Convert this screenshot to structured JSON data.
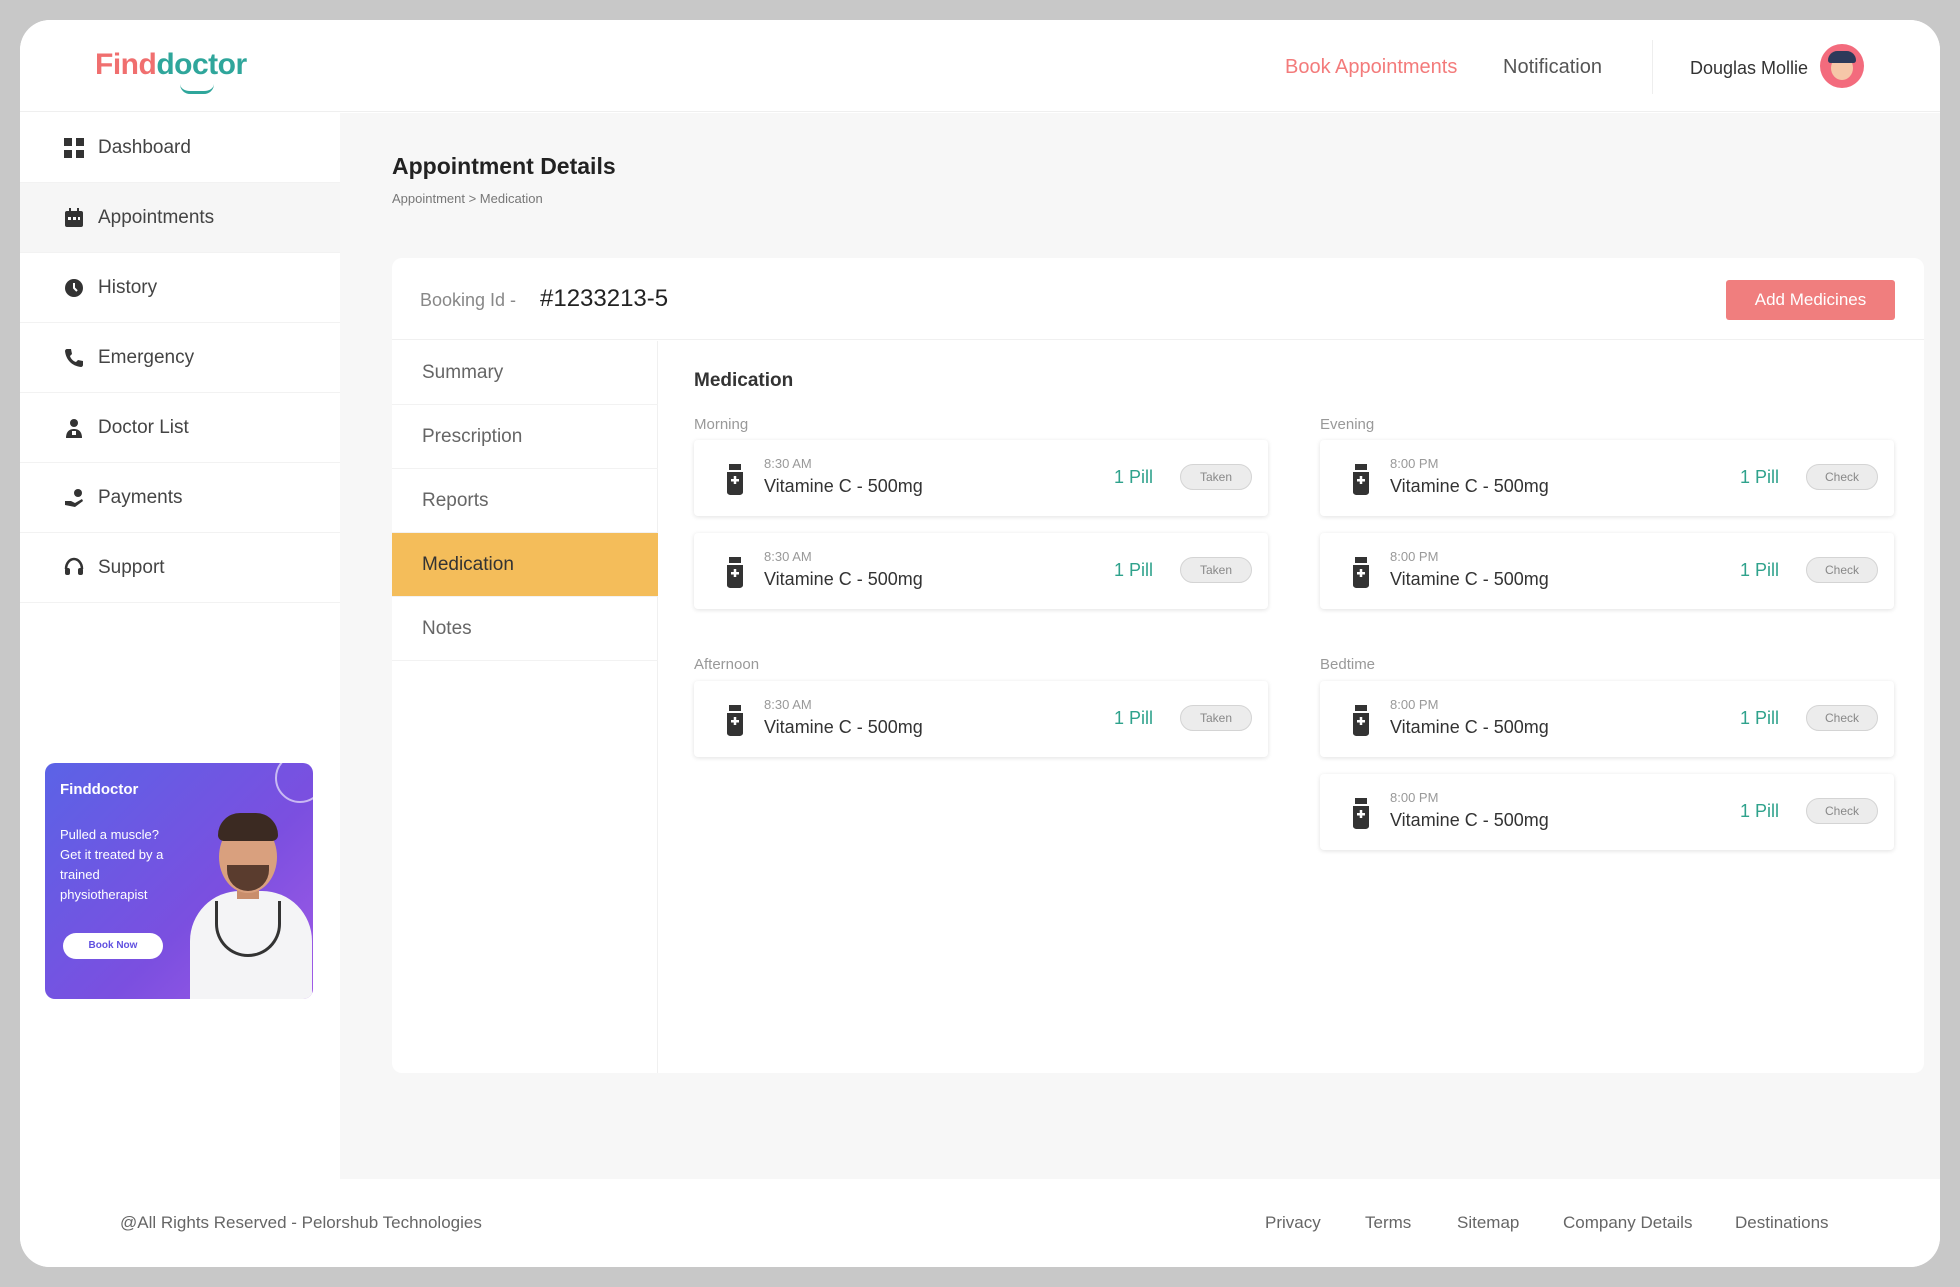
{
  "header": {
    "logo_part1": "Find",
    "logo_part2": "doctor",
    "book_link": "Book Appointments",
    "notification_link": "Notification",
    "user_name": "Douglas Mollie"
  },
  "sidebar": {
    "items": [
      {
        "label": "Dashboard",
        "icon": "grid-icon"
      },
      {
        "label": "Appointments",
        "icon": "calendar-icon",
        "active": true
      },
      {
        "label": "History",
        "icon": "clock-icon"
      },
      {
        "label": "Emergency",
        "icon": "phone-icon"
      },
      {
        "label": "Doctor List",
        "icon": "doctor-icon"
      },
      {
        "label": "Payments",
        "icon": "wallet-icon"
      },
      {
        "label": "Support",
        "icon": "headset-icon"
      }
    ],
    "banner": {
      "logo": "Finddoctor",
      "text": "Pulled a muscle? Get it treated by a trained physiotherapist",
      "button": "Book Now"
    }
  },
  "main": {
    "title": "Appointment Details",
    "breadcrumb": "Appointment > Medication",
    "booking_label": "Booking Id -",
    "booking_id": "#1233213-5",
    "add_button": "Add Medicines",
    "tabs": [
      "Summary",
      "Prescription",
      "Reports",
      "Medication",
      "Notes"
    ],
    "active_tab": "Medication",
    "medication_title": "Medication",
    "sections": {
      "morning": {
        "label": "Morning",
        "items": [
          {
            "time": "8:30 AM",
            "name": "Vitamine C - 500mg",
            "qty": "1 Pill",
            "status": "Taken"
          },
          {
            "time": "8:30 AM",
            "name": "Vitamine C - 500mg",
            "qty": "1 Pill",
            "status": "Taken"
          }
        ]
      },
      "evening": {
        "label": "Evening",
        "items": [
          {
            "time": "8:00 PM",
            "name": "Vitamine C - 500mg",
            "qty": "1 Pill",
            "status": "Check"
          },
          {
            "time": "8:00 PM",
            "name": "Vitamine C - 500mg",
            "qty": "1 Pill",
            "status": "Check"
          }
        ]
      },
      "afternoon": {
        "label": "Afternoon",
        "items": [
          {
            "time": "8:30 AM",
            "name": "Vitamine C - 500mg",
            "qty": "1 Pill",
            "status": "Taken"
          }
        ]
      },
      "bedtime": {
        "label": "Bedtime",
        "items": [
          {
            "time": "8:00 PM",
            "name": "Vitamine C - 500mg",
            "qty": "1 Pill",
            "status": "Check"
          },
          {
            "time": "8:00 PM",
            "name": "Vitamine C - 500mg",
            "qty": "1 Pill",
            "status": "Check"
          }
        ]
      }
    }
  },
  "footer": {
    "copyright": "@All Rights Reserved  -  Pelorshub Technologies",
    "links": [
      "Privacy",
      "Terms",
      "Sitemap",
      "Company Details",
      "Destinations"
    ]
  },
  "colors": {
    "accent": "#f07e7e",
    "active_tab": "#f4bd5a",
    "pill_qty": "#2fa28c",
    "logo_teal": "#2fa69b"
  }
}
